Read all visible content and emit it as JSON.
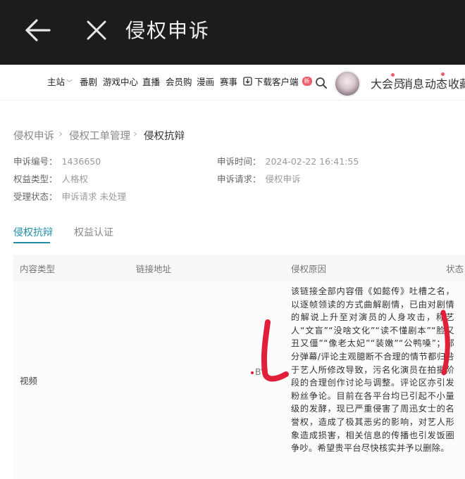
{
  "appbar": {
    "title": "侵权申诉"
  },
  "sitenav": {
    "items": [
      "主站",
      "番剧",
      "游戏中心",
      "直播",
      "会员购",
      "漫画",
      "赛事"
    ],
    "download_label": "下载客户端",
    "download_badge": "新",
    "right_items": [
      "大会员",
      "消息",
      "动态",
      "收藏"
    ]
  },
  "breadcrumb": [
    "侵权申诉",
    "侵权工单管理",
    "侵权抗辩"
  ],
  "info": {
    "complaint_no_label": "申诉编号：",
    "complaint_no": "1436650",
    "complaint_time_label": "申诉时间：",
    "complaint_time": "2024-02-22 16:41:55",
    "rights_type_label": "权益类型：",
    "rights_type": "人格权",
    "request_label": "申诉请求：",
    "request": "侵权申诉",
    "status_label": "受理状态：",
    "status": "申诉请求 未处理"
  },
  "tabs": [
    "侵权抗辩",
    "权益认证"
  ],
  "table": {
    "headers": [
      "内容类型",
      "链接地址",
      "侵权原因",
      "状态"
    ],
    "rows": [
      {
        "type": "视频",
        "link": "BV",
        "reason": "该链接全部内容借《如懿传》吐槽之名，以逐帧领读的方式曲解剧情，已由对剧情的解说上升至对演员的人身攻击，称艺人“文盲”“没啥文化”“读不懂剧本”“脸又丑又僵”“像老太妃”“装嫩”“公鸭嗓”；部分弹幕/评论主观臆断不合理的情节都归咎于艺人所修改导致，污名化演员在拍摄阶段的合理创作讨论与调整。评论区亦引发粉丝争论。目前在各平台均已引起不小量级的发酵，现已严重侵害了周迅女士的名誉权，造成了极其恶劣的影响，对艺人形象造成损害，相关信息的传播也引发饭圈争吵。希望贵平台尽快核实并予以删除。"
      }
    ]
  },
  "colors": {
    "accent": "#1f8fa8",
    "annotation": "#e0203a",
    "appbar_bg": "#1c1c1c"
  }
}
